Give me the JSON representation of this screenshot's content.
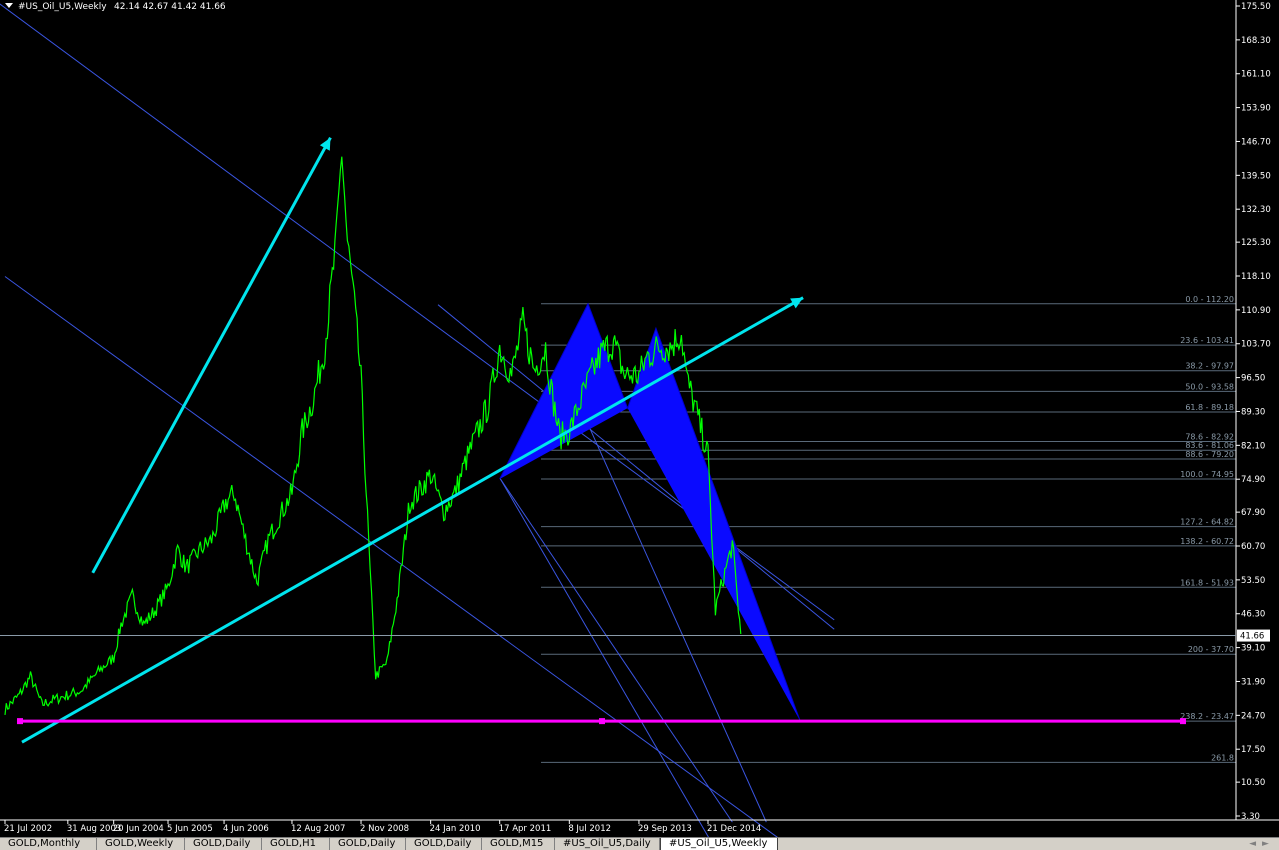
{
  "header": {
    "symbol": "#US_Oil_U5,Weekly",
    "ohlc": "42.14 42.67 41.42 41.66"
  },
  "colors": {
    "background": "#000000",
    "price": "#00ff00",
    "trend_arrows": "#00e5ee",
    "channels": "#3a55e0",
    "fib_levels": "#5a6a7a",
    "pattern_fill": "#0a0aff",
    "support": "#ff00ff",
    "axis_text": "#ffffff",
    "fib_text": "#8a9aa8"
  },
  "tabs": [
    "GOLD,Monthly",
    "GOLD,Weekly",
    "GOLD,Daily",
    "GOLD,H1",
    "GOLD,Daily",
    "GOLD,Daily",
    "GOLD,M15",
    "#US_Oil_U5,Daily",
    "#US_Oil_U5,Weekly"
  ],
  "active_tab": 8,
  "chart_data": {
    "type": "line",
    "title": "#US_Oil_U5,Weekly",
    "x_ticks": [
      "21 Jul 2002",
      "31 Aug 2003",
      "20 Jun 2004",
      "5 Jun 2005",
      "4 Jun 2006",
      "12 Aug 2007",
      "2 Nov 2008",
      "24 Jan 2010",
      "17 Apr 2011",
      "8 Jul 2012",
      "29 Sep 2013",
      "21 Dec 2014"
    ],
    "y_ticks": [
      "175.50",
      "168.30",
      "161.10",
      "153.90",
      "146.70",
      "139.50",
      "132.30",
      "125.30",
      "118.10",
      "110.90",
      "103.70",
      "96.50",
      "89.30",
      "82.10",
      "74.90",
      "67.90",
      "60.70",
      "53.50",
      "46.30",
      "39.10",
      "31.90",
      "24.70",
      "17.50",
      "10.50",
      "3.30"
    ],
    "ylim": [
      3.3,
      175.5
    ],
    "last_price": "41.66",
    "series": [
      {
        "x": [
          2002.55,
          2002.8,
          2003.0,
          2003.2,
          2003.4,
          2003.66,
          2003.9,
          2004.2,
          2004.47,
          2004.6,
          2004.8,
          2005.0,
          2005.2,
          2005.43,
          2005.6,
          2005.75,
          2006.0,
          2006.2,
          2006.45,
          2006.6,
          2006.8,
          2007.0,
          2007.2,
          2007.4,
          2007.62,
          2007.8,
          2008.0,
          2008.2,
          2008.4,
          2008.5,
          2008.6,
          2008.7,
          2008.84,
          2009.0,
          2009.1,
          2009.3,
          2009.5,
          2009.7,
          2009.85,
          2010.07,
          2010.3,
          2010.5,
          2010.7,
          2010.9,
          2011.1,
          2011.29,
          2011.5,
          2011.7,
          2011.9,
          2012.1,
          2012.2,
          2012.35,
          2012.52,
          2012.7,
          2012.9,
          2013.1,
          2013.3,
          2013.5,
          2013.75,
          2013.9,
          2014.1,
          2014.3,
          2014.5,
          2014.6,
          2014.75,
          2014.97,
          2015.1,
          2015.2,
          2015.4,
          2015.55
        ],
        "y": [
          26,
          29,
          33,
          27,
          28,
          29,
          30,
          34,
          37,
          44,
          50,
          44,
          47,
          52,
          60,
          56,
          60,
          62,
          70,
          72,
          62,
          53,
          62,
          67,
          72,
          85,
          92,
          103,
          125,
          145,
          125,
          115,
          96,
          55,
          33,
          36,
          51,
          70,
          72,
          76,
          68,
          72,
          79,
          85,
          91,
          103,
          97,
          108,
          98,
          103,
          94,
          84,
          85,
          91,
          97,
          102,
          104,
          97,
          97,
          101,
          103,
          103,
          106,
          96,
          90,
          80,
          47,
          52,
          61,
          42
        ]
      }
    ],
    "fib_levels": [
      {
        "label": "0.0 - 112.20",
        "value": 112.2
      },
      {
        "label": "23.6 - 103.41",
        "value": 103.41
      },
      {
        "label": "38.2 - 97.97",
        "value": 97.97
      },
      {
        "label": "50.0 - 93.58",
        "value": 93.58
      },
      {
        "label": "61.8 - 89.18",
        "value": 89.18
      },
      {
        "label": "78.6 - 82.92",
        "value": 82.92
      },
      {
        "label": "83.6 - 81.06",
        "value": 81.06
      },
      {
        "label": "88.6 - 79.20",
        "value": 79.2
      },
      {
        "label": "100.0 - 74.95",
        "value": 74.95
      },
      {
        "label": "127.2 - 64.82",
        "value": 64.82
      },
      {
        "label": "138.2 - 60.72",
        "value": 60.72
      },
      {
        "label": "161.8 - 51.93",
        "value": 51.93
      },
      {
        "label": "200 - 37.70",
        "value": 37.7
      },
      {
        "label": "238.2 - 23.47",
        "value": 23.47
      },
      {
        "label": "261.8",
        "value": 14.7
      }
    ],
    "support_level": 23.47,
    "harmonic_pattern": [
      {
        "x": 2011.29,
        "y": 74.95
      },
      {
        "x": 2012.85,
        "y": 112.2
      },
      {
        "x": 2013.55,
        "y": 90.0
      },
      {
        "x": 2014.05,
        "y": 107.0
      },
      {
        "x": 2016.6,
        "y": 23.47
      }
    ]
  }
}
